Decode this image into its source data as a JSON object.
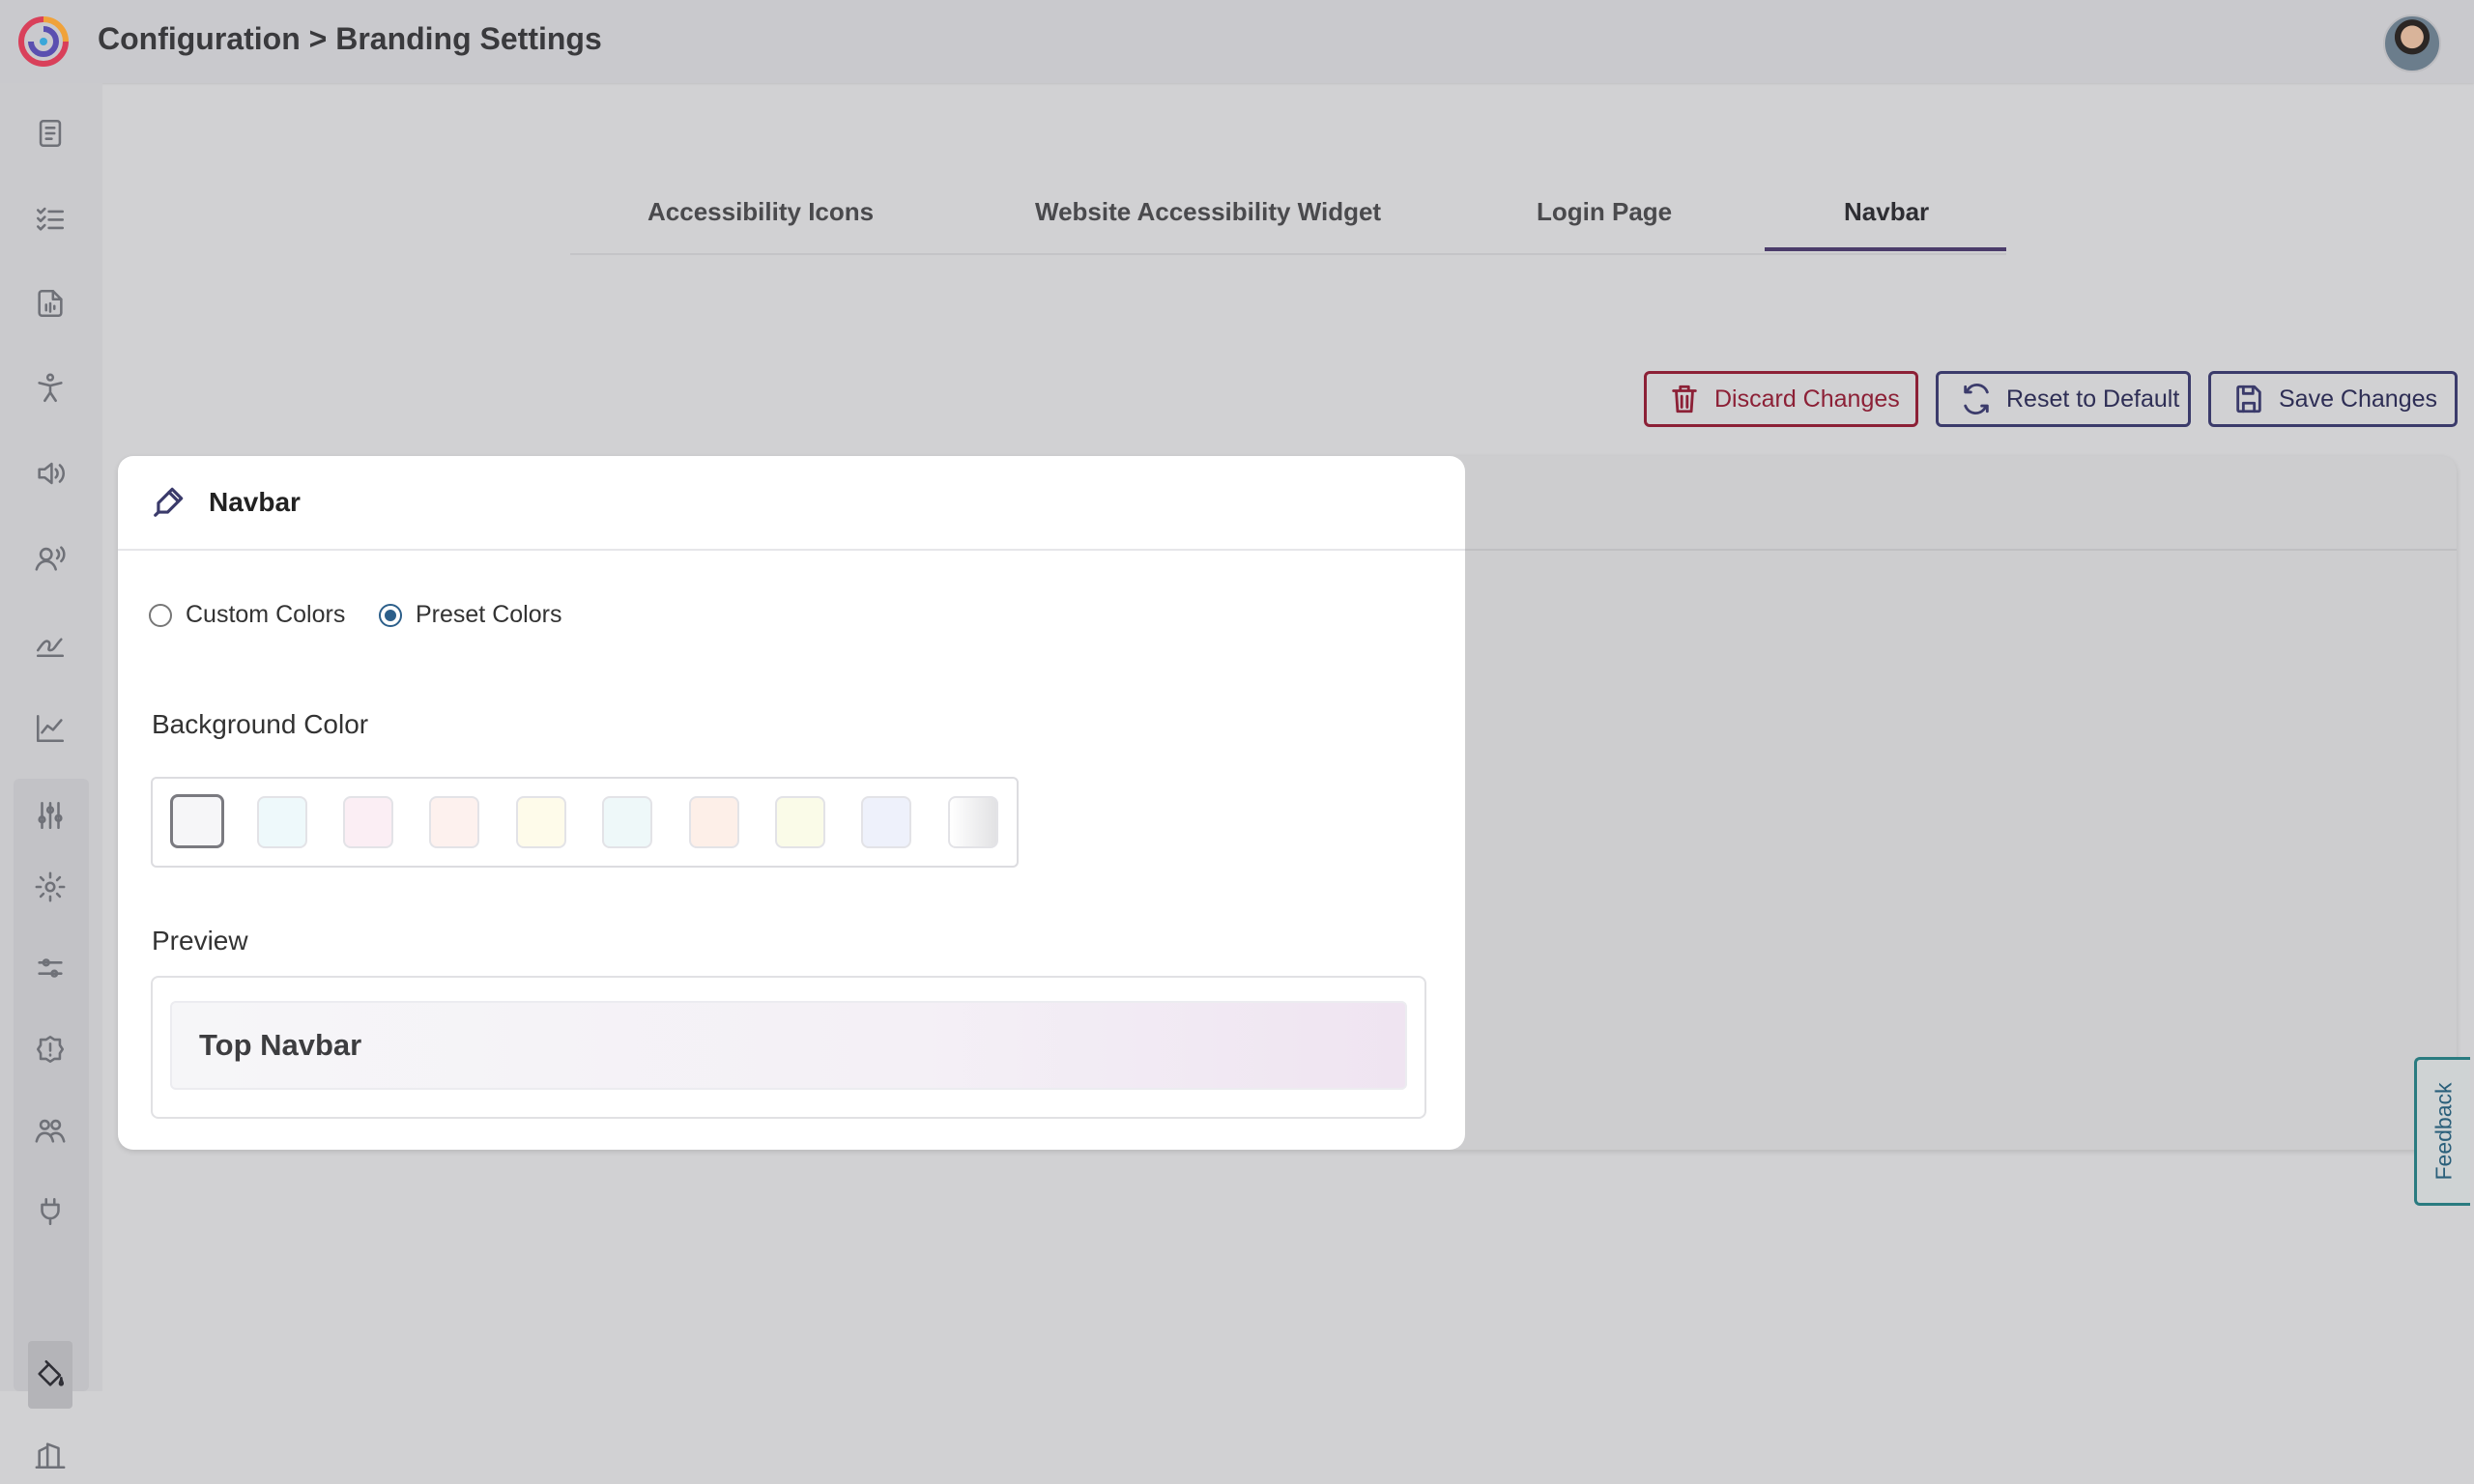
{
  "header": {
    "breadcrumb": "Configuration > Branding Settings",
    "logo_icon": "swirl-logo-icon",
    "avatar_icon": "user-avatar"
  },
  "sidebar": {
    "items": [
      {
        "icon": "document-list-icon"
      },
      {
        "icon": "checklist-icon"
      },
      {
        "icon": "audio-file-icon"
      },
      {
        "icon": "accessibility-person-icon"
      },
      {
        "icon": "speaker-icon"
      },
      {
        "icon": "voice-user-icon"
      },
      {
        "icon": "signature-icon"
      },
      {
        "icon": "line-chart-icon"
      },
      {
        "icon": "sliders-icon"
      },
      {
        "icon": "gear-icon"
      },
      {
        "icon": "filter-sliders-icon"
      },
      {
        "icon": "alert-badge-icon"
      },
      {
        "icon": "users-group-icon"
      },
      {
        "icon": "plug-icon"
      },
      {
        "icon": "paint-bucket-icon"
      },
      {
        "icon": "building-icon"
      }
    ]
  },
  "tabs": [
    {
      "label": "Accessibility Icons"
    },
    {
      "label": "Website Accessibility Widget"
    },
    {
      "label": "Login Page"
    },
    {
      "label": "Navbar",
      "active": true
    }
  ],
  "actions": {
    "discard_label": "Discard Changes",
    "reset_label": "Reset to Default",
    "save_label": "Save Changes"
  },
  "panel": {
    "title": "Navbar",
    "icon": "eyedropper-icon",
    "color_mode_options": [
      {
        "label": "Custom Colors",
        "checked": false
      },
      {
        "label": "Preset Colors",
        "checked": true
      }
    ],
    "background_color_label": "Background Color",
    "swatches": [
      {
        "color": "#f6f6f8",
        "selected": true
      },
      {
        "color": "#eef9fb",
        "selected": false
      },
      {
        "color": "#fbeef4",
        "selected": false
      },
      {
        "color": "#fdf1ee",
        "selected": false
      },
      {
        "color": "#fefbea",
        "selected": false
      },
      {
        "color": "#eef8f9",
        "selected": false
      },
      {
        "color": "#fdefe8",
        "selected": false
      },
      {
        "color": "#fafbe8",
        "selected": false
      },
      {
        "color": "#eef1fb",
        "selected": false
      },
      {
        "color": "#e9e9eb",
        "selected": false
      }
    ],
    "preview_label": "Preview",
    "preview_text": "Top Navbar"
  },
  "feedback": {
    "label": "Feedback"
  },
  "colors": {
    "accent": "#4b3c6a",
    "danger": "#8c2036",
    "radio_checked": "#2c5f8a",
    "feedback": "#2a7b80"
  }
}
